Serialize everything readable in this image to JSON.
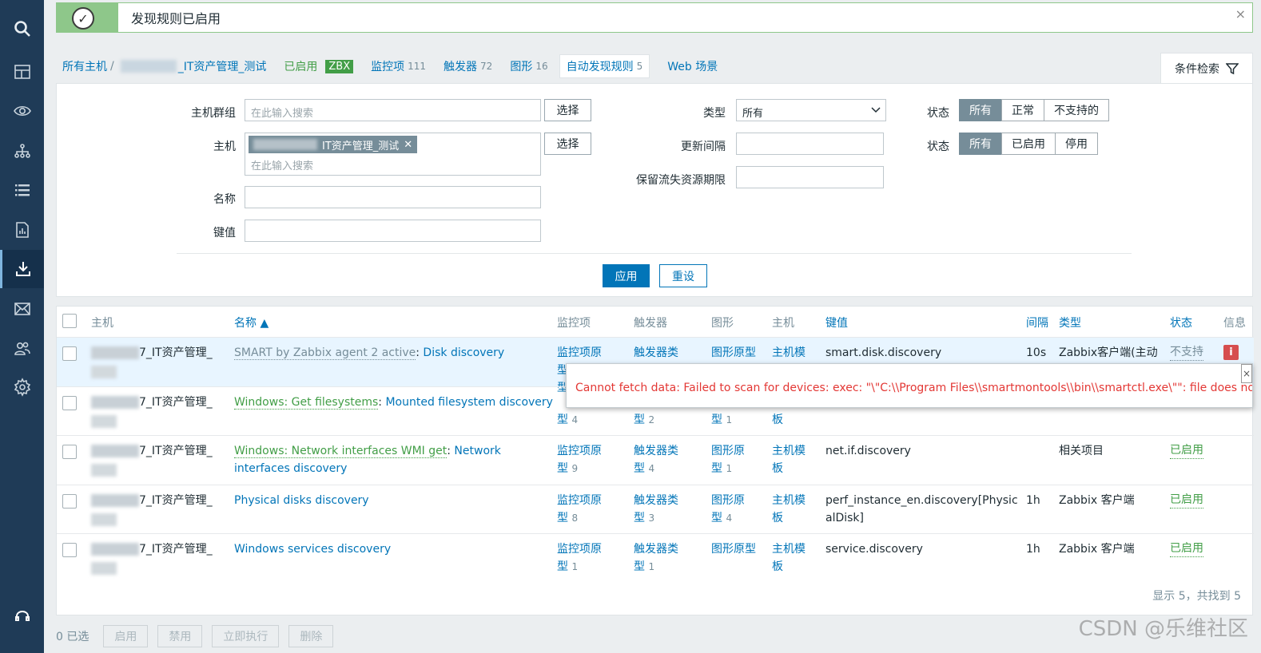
{
  "sidebar": {
    "icons": [
      "search-icon",
      "dashboard-icon",
      "monitoring-eye-icon",
      "inventory-tree-icon",
      "list-icon",
      "reports-icon",
      "data-collection-icon",
      "alerts-mail-icon",
      "users-icon",
      "settings-gear-icon",
      "support-headset-icon"
    ],
    "active": "data-collection-icon"
  },
  "message": {
    "text": "发现规则已启用",
    "close": "×"
  },
  "nav": {
    "all_hosts": "所有主机",
    "sep": "/",
    "host_suffix": "_IT资产管理_测试",
    "enabled": "已启用",
    "zbx": "ZBX",
    "items": "监控项",
    "items_count": "111",
    "triggers": "触发器",
    "triggers_count": "72",
    "graphs": "图形",
    "graphs_count": "16",
    "discovery": "自动发现规则",
    "discovery_count": "5",
    "web": "Web 场景"
  },
  "filter_tab": {
    "label": "条件检索"
  },
  "filter": {
    "hostgroup_label": "主机群组",
    "hostgroup_placeholder": "在此输入搜索",
    "select": "选择",
    "host_label": "主机",
    "host_tag": "IT资产管理_测试",
    "host_placeholder": "在此输入搜索",
    "name_label": "名称",
    "key_label": "键值",
    "type_label": "类型",
    "type_value": "所有",
    "interval_label": "更新间隔",
    "keep_lost_label": "保留流失资源期限",
    "state_label": "状态",
    "state_options": [
      "所有",
      "正常",
      "不支持的"
    ],
    "status_label": "状态",
    "status_options": [
      "所有",
      "已启用",
      "停用"
    ],
    "apply": "应用",
    "reset": "重设"
  },
  "table": {
    "headers": {
      "host": "主机",
      "name": "名称 ▲",
      "items": "监控项",
      "triggers": "触发器",
      "graphs": "图形",
      "hosts": "主机",
      "key": "键值",
      "interval": "间隔",
      "type": "类型",
      "status": "状态",
      "info": "信息"
    },
    "host_suffix": "7_IT资产管理_",
    "rows": [
      {
        "template": "SMART by Zabbix agent 2 active",
        "name": "Disk discovery",
        "items": "监控项原型",
        "items_n": "",
        "triggers": "触发器类",
        "triggers_n": "",
        "graphs": "图形原型",
        "graphs_n": "",
        "hosts": "主机模",
        "key": "smart.disk.discovery",
        "interval": "10s",
        "type": "Zabbix客户端(主动",
        "status": "不支持"
      },
      {
        "template": "Windows: Get filesystems",
        "name": "Mounted filesystem discovery",
        "items": "型",
        "items_n": "4",
        "triggers": "型",
        "triggers_n": "2",
        "graphs": "型",
        "graphs_n": "1",
        "hosts": "板",
        "key": "",
        "interval": "",
        "type": "",
        "status": ""
      },
      {
        "template": "Windows: Network interfaces WMI get",
        "name": "Network interfaces discovery",
        "items": "监控项原",
        "items2": "型",
        "items_n": "9",
        "triggers": "触发器类",
        "triggers2": "型",
        "triggers_n": "4",
        "graphs": "图形原",
        "graphs2": "型",
        "graphs_n": "1",
        "hosts": "主机模",
        "hosts2": "板",
        "key": "net.if.discovery",
        "interval": "",
        "type": "相关项目",
        "status": "已启用"
      },
      {
        "template": "",
        "name": "Physical disks discovery",
        "items": "监控项原",
        "items2": "型",
        "items_n": "8",
        "triggers": "触发器类",
        "triggers2": "型",
        "triggers_n": "3",
        "graphs": "图形原",
        "graphs2": "型",
        "graphs_n": "4",
        "hosts": "主机模",
        "hosts2": "板",
        "key": "perf_instance_en.discovery[Physic",
        "key2": "alDisk]",
        "interval": "1h",
        "type": "Zabbix 客户端",
        "status": "已启用"
      },
      {
        "template": "",
        "name": "Windows services discovery",
        "items": "监控项原",
        "items2": "型",
        "items_n": "1",
        "triggers": "触发器类",
        "triggers2": "型",
        "triggers_n": "1",
        "graphs": "图形原型",
        "hosts": "主机模",
        "hosts2": "板",
        "key": "service.discovery",
        "interval": "1h",
        "type": "Zabbix 客户端",
        "status": "已启用"
      }
    ],
    "footer": "显示 5，共找到 5"
  },
  "tooltip": {
    "text": "Cannot fetch data: Failed to scan for devices: exec: \"\\\"C:\\\\Program Files\\\\smartmontools\\\\bin\\\\smartctl.exe\\\"\": file does not exist.",
    "close": "×"
  },
  "row1_items_line2": "型",
  "actions": {
    "selected": "0 已选",
    "enable": "启用",
    "disable": "禁用",
    "execute": "立即执行",
    "delete": "删除"
  },
  "watermark": "CSDN @乐维社区"
}
